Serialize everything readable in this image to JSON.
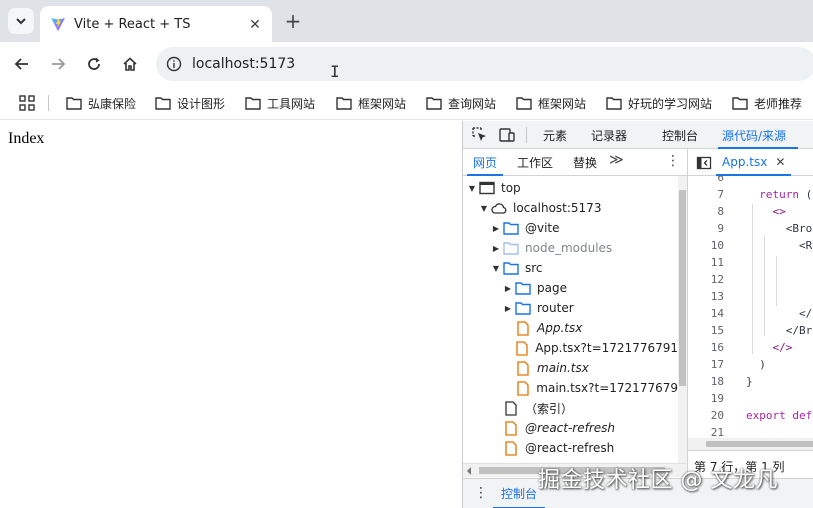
{
  "browser": {
    "tab": {
      "title": "Vite + React + TS",
      "close": "✕"
    },
    "new_tab": "+",
    "url": "localhost:5173",
    "text_cursor": "I",
    "bookmarks": [
      "弘康保险",
      "设计图形",
      "工具网站",
      "框架网站",
      "查询网站",
      "框架网站",
      "好玩的学习网站",
      "老师推荐"
    ]
  },
  "page": {
    "text": "Index"
  },
  "devtools": {
    "tabs": [
      "元素",
      "记录器",
      "控制台",
      "源代码/来源"
    ],
    "active_tab": "源代码/来源",
    "navigator": {
      "tabs": [
        "网页",
        "工作区",
        "替换"
      ],
      "more": "≫",
      "menu": "⋮",
      "tree": [
        {
          "label": "top",
          "arrow": "▼",
          "icon": "frame-icon",
          "depth": 0
        },
        {
          "label": "localhost:5173",
          "arrow": "▼",
          "icon": "cloud-icon",
          "depth": 1
        },
        {
          "label": "@vite",
          "arrow": "▶",
          "icon": "folder-icon",
          "depth": 2
        },
        {
          "label": "node_modules",
          "arrow": "▶",
          "icon": "folder-dim-icon",
          "depth": 2,
          "dim": true
        },
        {
          "label": "src",
          "arrow": "▼",
          "icon": "folder-icon",
          "depth": 2
        },
        {
          "label": "page",
          "arrow": "▶",
          "icon": "folder-icon",
          "depth": 3
        },
        {
          "label": "router",
          "arrow": "▶",
          "icon": "folder-icon",
          "depth": 3
        },
        {
          "label": "App.tsx",
          "arrow": "",
          "icon": "file-orange-icon",
          "depth": 3,
          "italic": true
        },
        {
          "label": "App.tsx?t=1721776791",
          "arrow": "",
          "icon": "file-orange-icon",
          "depth": 3
        },
        {
          "label": "main.tsx",
          "arrow": "",
          "icon": "file-orange-icon",
          "depth": 3,
          "italic": true
        },
        {
          "label": "main.tsx?t=172177679",
          "arrow": "",
          "icon": "file-orange-icon",
          "depth": 3
        },
        {
          "label": "（索引）",
          "arrow": "",
          "icon": "file-icon",
          "depth": 2
        },
        {
          "label": "@react-refresh",
          "arrow": "",
          "icon": "file-orange-icon",
          "depth": 2,
          "italic": true
        },
        {
          "label": "@react-refresh",
          "arrow": "",
          "icon": "file-orange-icon",
          "depth": 2
        }
      ]
    },
    "editor": {
      "file_tab": "App.tsx",
      "file_tab_close": "✕",
      "lines": [
        {
          "n": "6",
          "code": ""
        },
        {
          "n": "7",
          "code": "  return ("
        },
        {
          "n": "8",
          "code": "    <>"
        },
        {
          "n": "9",
          "code": "      <Bro"
        },
        {
          "n": "10",
          "code": "        <R"
        },
        {
          "n": "11",
          "code": ""
        },
        {
          "n": "12",
          "code": ""
        },
        {
          "n": "13",
          "code": ""
        },
        {
          "n": "14",
          "code": "        </"
        },
        {
          "n": "15",
          "code": "      </Br"
        },
        {
          "n": "16",
          "code": "    </>"
        },
        {
          "n": "17",
          "code": "  )"
        },
        {
          "n": "18",
          "code": "}"
        },
        {
          "n": "19",
          "code": ""
        },
        {
          "n": "20",
          "code": "export def"
        },
        {
          "n": "21",
          "code": ""
        }
      ],
      "status": "第 7 行，第 1 列"
    },
    "drawer": {
      "menu": "⋮",
      "tab": "控制台"
    }
  },
  "watermark": "掘金技术社区 @ 文龙凡"
}
